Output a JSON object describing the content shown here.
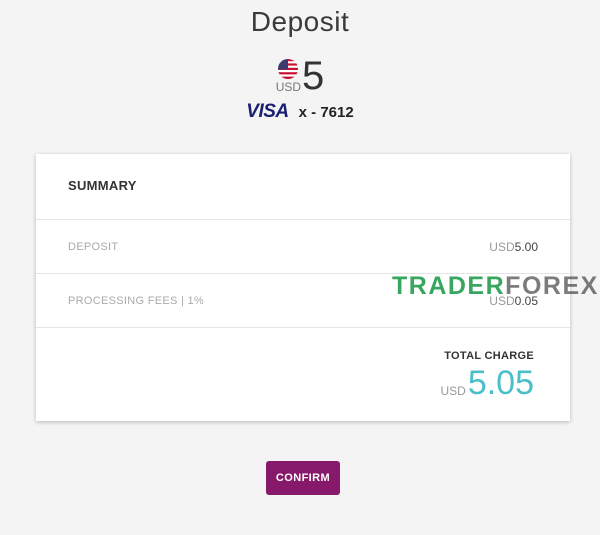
{
  "page": {
    "title": "Deposit"
  },
  "amount": {
    "currency_code": "USD",
    "value": "5",
    "flag_icon": "us-flag-icon"
  },
  "card": {
    "brand": "VISA",
    "masked_number": "x - 7612",
    "brand_color": "#1a1f71"
  },
  "summary": {
    "heading": "SUMMARY",
    "lines": [
      {
        "label": "DEPOSIT",
        "currency": "USD",
        "value": "5.00"
      },
      {
        "label": "PROCESSING FEES | 1%",
        "currency": "USD",
        "value": "0.05"
      }
    ],
    "total": {
      "label": "TOTAL CHARGE",
      "currency": "USD",
      "value": "5.05",
      "color": "#4bbfc9"
    }
  },
  "watermark": {
    "text_main": "TRADER",
    "text_light": "FOREX"
  },
  "actions": {
    "confirm_label": "CONFIRM",
    "confirm_color": "#86196a"
  }
}
